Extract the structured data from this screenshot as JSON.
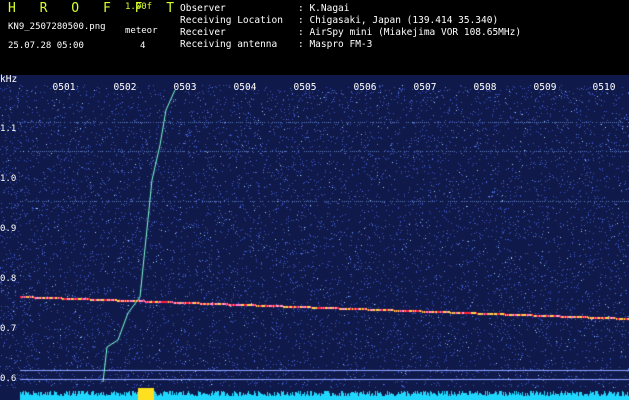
{
  "header": {
    "logo": "H R O F F T",
    "version": "1.00f",
    "filename": "KN9_2507280500.png",
    "meteor_label": "meteor",
    "meteor_count": "4",
    "datetime": "25.07.28 05:00"
  },
  "meta": [
    {
      "key": "Observer",
      "value": ": K.Nagai"
    },
    {
      "key": "Receiving Location",
      "value": ": Chigasaki, Japan (139.414 35.340)"
    },
    {
      "key": "Receiver",
      "value": ": AirSpy mini (Miakejima VOR 108.65MHz)"
    },
    {
      "key": "Receiving antenna",
      "value": ": Maspro FM-3"
    }
  ],
  "plot": {
    "y_unit": "kHz",
    "y_ticks": [
      "1.1",
      "1.0",
      "0.9",
      "0.8",
      "0.7",
      "0.6"
    ],
    "x_ticks": [
      "0501",
      "0502",
      "0503",
      "0504",
      "0505",
      "0506",
      "0507",
      "0508",
      "0509",
      "0510"
    ],
    "colors": {
      "background": "#101a4a",
      "noise": "#3a54c8",
      "carrier": "#ff2040",
      "meteor": "#7fffd4",
      "level_bar": "#20d8ff"
    }
  }
}
